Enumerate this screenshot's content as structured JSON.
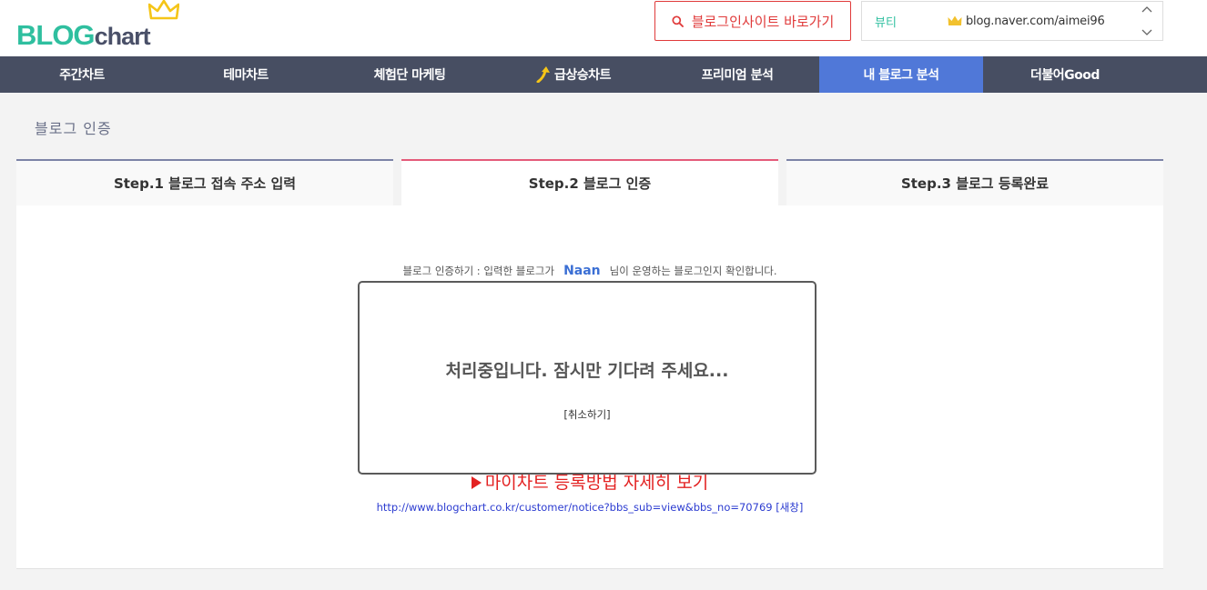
{
  "logo": {
    "part1": "BLOG",
    "part2": "chart"
  },
  "header": {
    "goto_button": "블로그인사이트 바로가기",
    "blog_select": {
      "category": "뷰티",
      "url": "blog.naver.com/aimei96"
    }
  },
  "nav": {
    "items": [
      {
        "label": "주간차트"
      },
      {
        "label": "테마차트"
      },
      {
        "label": "체험단 마케팅"
      },
      {
        "label": "급상승차트"
      },
      {
        "label": "프리미엄 분석"
      },
      {
        "label": "내 블로그 분석"
      },
      {
        "label": "더불어Good"
      }
    ],
    "active_index": 5
  },
  "page": {
    "title": "블로그 인증"
  },
  "steps": [
    {
      "label": "Step.1 블로그 접속 주소 입력"
    },
    {
      "label": "Step.2 블로그 인증"
    },
    {
      "label": "Step.3 블로그 등록완료"
    }
  ],
  "verify": {
    "prefix": "블로그 인증하기 : 입력한 블로그가",
    "nickname": "Naan",
    "suffix": "님이 운영하는 블로그인지 확인합니다."
  },
  "howto": {
    "link_text": "마이차트 등록방법 자세히 보기",
    "url": "http://www.blogchart.co.kr/customer/notice?bbs_sub=view&bbs_no=70769",
    "new_window": "[새창]"
  },
  "modal": {
    "message": "처리중입니다. 잠시만 기다려 주세요...",
    "cancel": "[취소하기]"
  },
  "colors": {
    "brand_green": "#2fbf9f",
    "nav_bg": "#474e62",
    "nav_active": "#5078d8",
    "accent_red": "#e03a3a",
    "step_active": "#e45b7a"
  }
}
